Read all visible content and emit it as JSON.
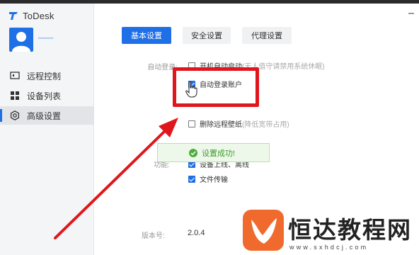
{
  "app": {
    "title": "ToDesk",
    "username": "───"
  },
  "sidebar": {
    "items": [
      {
        "label": "远程控制",
        "icon": "monitor-icon"
      },
      {
        "label": "设备列表",
        "icon": "grid-icon"
      },
      {
        "label": "高级设置",
        "icon": "gear-icon"
      }
    ],
    "active_index": 2
  },
  "tabs": [
    {
      "label": "基本设置",
      "active": true
    },
    {
      "label": "安全设置",
      "active": false
    },
    {
      "label": "代理设置",
      "active": false
    }
  ],
  "settings": {
    "autostart_label": "自动登录:",
    "opt_autostart": {
      "label": "开机自动启动",
      "hint": "(无人值守请禁用系统休眠)",
      "checked": false
    },
    "opt_autologin": {
      "label": "自动登录账户",
      "checked": true
    },
    "opt_wallpaper": {
      "label": "删除远程壁纸",
      "hint": "(降低宽带占用)",
      "checked": false
    },
    "clipboard_label": "功能:",
    "opt_clipboard": {
      "label": "设备上线、离线",
      "checked": true
    },
    "opt_filetransfer": {
      "label": "文件传输",
      "checked": true
    }
  },
  "toast": {
    "text": "设置成功!"
  },
  "version": {
    "label": "版本号:",
    "value": "2.0.4"
  },
  "watermark": {
    "text": "恒达教程网",
    "url": "www.sxhdcj.com"
  },
  "colors": {
    "accent": "#1f6fe6",
    "highlight": "#e0161c",
    "success": "#3b9b2a",
    "watermark": "#f06a2e"
  }
}
